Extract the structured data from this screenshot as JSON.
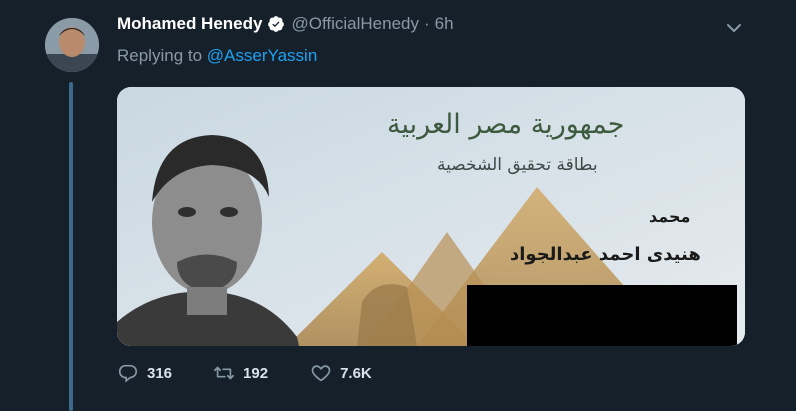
{
  "tweet": {
    "author_name": "Mohamed Henedy",
    "handle": "@OfficialHenedy",
    "separator": "·",
    "time": "6h",
    "replying_prefix": "Replying to",
    "replying_to": "@AsserYassin",
    "media": {
      "header_line1": "جمهورية مصر العربية",
      "header_line2": "بطاقة تحقيق الشخصية",
      "first_name": "محمد",
      "full_name": "هنيدى احمد عبدالجواد"
    },
    "actions": {
      "reply_count": "316",
      "retweet_count": "192",
      "like_count": "7.6K"
    }
  },
  "colors": {
    "background": "#15202b",
    "secondary_text": "#8899a6",
    "link": "#1da1f2",
    "thread_line": "#3b6a8e"
  },
  "icons": [
    "verified-badge-icon",
    "chevron-down-icon",
    "reply-icon",
    "retweet-icon",
    "like-icon"
  ]
}
